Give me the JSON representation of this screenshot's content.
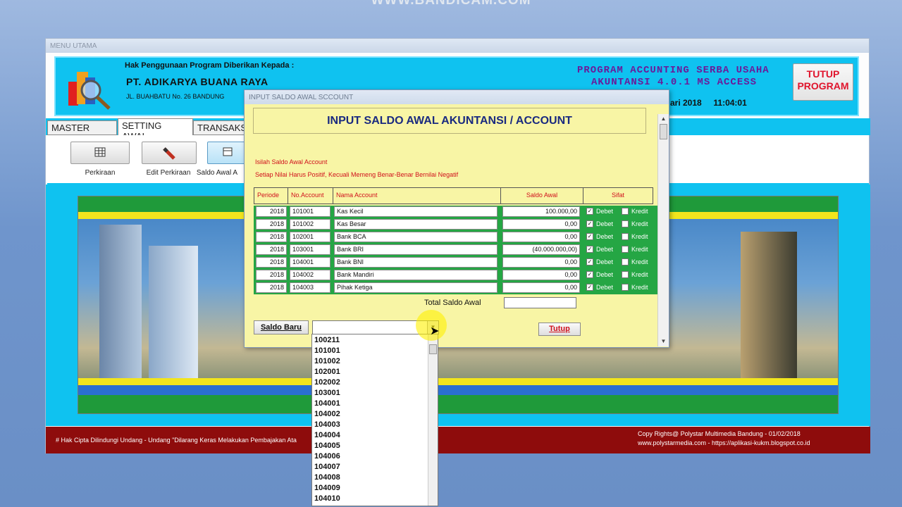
{
  "watermark": "WWW.BANDICAM.COM",
  "main_window": {
    "title": "MENU UTAMA",
    "license_label": "Hak Penggunaan Program Diberikan Kepada :",
    "company_name": "PT. ADIKARYA BUANA RAYA",
    "company_address": "JL. BUAHBATU No. 26 BANDUNG",
    "program_title": "PROGRAM ACCUNTING  SERBA USAHA",
    "program_version": "AKUNTANSI 4.0.1  MS ACCESS",
    "date_partial": "ari 2018",
    "time": "11:04:01",
    "close_program_line1": "TUTUP",
    "close_program_line2": "PROGRAM"
  },
  "tabs": [
    {
      "label": "MASTER DATA"
    },
    {
      "label": "SETTING AWAL"
    },
    {
      "label": "TRANSAKSI"
    }
  ],
  "toolbar": [
    {
      "label": "Perkiraan"
    },
    {
      "label": "Edit Perkiraan"
    },
    {
      "label": "Saldo Awal A"
    }
  ],
  "footer": {
    "left": "# Hak Cipta Dilindungi Undang - Undang  \"Dilarang Keras Melakukan Pembajakan Ata",
    "copyright": "Copy Rights@ Polystar Multimedia Bandung - 01/02/2018",
    "websites": "www.polystarmedia.com  - https://aplikasi-kukm.blogspot.co.id"
  },
  "dialog": {
    "title": "INPUT SALDO AWAL SCCOUNT",
    "header": "INPUT SALDO AWAL AKUNTANSI / ACCOUNT",
    "note1": "Isilah Saldo Awal Account",
    "note2": "Setiap Nilai Harus Positif, Kecuali Memeng Benar-Benar Bernilai Negatif",
    "columns": [
      "Periode",
      "No.Account",
      "Nama Account",
      "Saldo Awal",
      "Sifat"
    ],
    "debit_label": "Debet",
    "credit_label": "Kredit",
    "rows": [
      {
        "periode": "2018",
        "account": "101001",
        "name": "Kas Kecil",
        "saldo": "100.000,00"
      },
      {
        "periode": "2018",
        "account": "101002",
        "name": "Kas Besar",
        "saldo": "0,00"
      },
      {
        "periode": "2018",
        "account": "102001",
        "name": "Bank BCA",
        "saldo": "0,00"
      },
      {
        "periode": "2018",
        "account": "103001",
        "name": "Bank BRI",
        "saldo": "(40.000.000,00)"
      },
      {
        "periode": "2018",
        "account": "104001",
        "name": "Bank BNI",
        "saldo": "0,00"
      },
      {
        "periode": "2018",
        "account": "104002",
        "name": "Bank Mandiri",
        "saldo": "0,00"
      },
      {
        "periode": "2018",
        "account": "104003",
        "name": "Pihak Ketiga",
        "saldo": "0,00"
      }
    ],
    "total_label": "Total Saldo Awal",
    "new_balance_button": "Saldo Baru",
    "close_button": "Tutup"
  },
  "dropdown_options": [
    "100211",
    "101001",
    "101002",
    "102001",
    "102002",
    "103001",
    "104001",
    "104002",
    "104003",
    "104004",
    "104005",
    "104006",
    "104007",
    "104008",
    "104009",
    "104010"
  ]
}
